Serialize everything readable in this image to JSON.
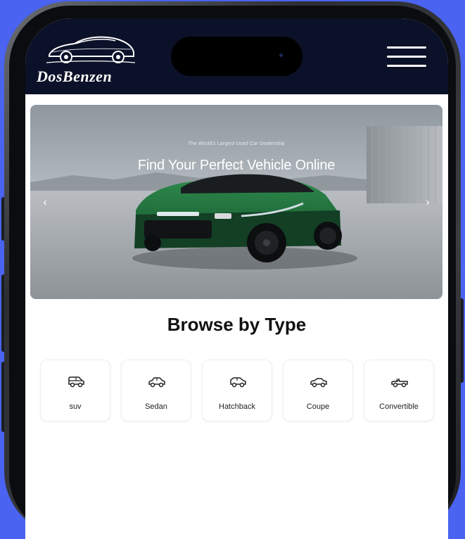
{
  "header": {
    "brand": "DosBenzen"
  },
  "hero": {
    "tagline": "The World's Largest Used Car Dealership",
    "title": "Find Your Perfect Vehicle Online",
    "prev_icon": "‹",
    "next_icon": "›"
  },
  "browse": {
    "title": "Browse by Type",
    "types": [
      {
        "label": "suv",
        "icon": "suv-icon"
      },
      {
        "label": "Sedan",
        "icon": "sedan-icon"
      },
      {
        "label": "Hatchback",
        "icon": "hatchback-icon"
      },
      {
        "label": "Coupe",
        "icon": "coupe-icon"
      },
      {
        "label": "Convertible",
        "icon": "convertible-icon"
      }
    ]
  },
  "colors": {
    "background": "#4a63f0",
    "navbar": "#0b1128",
    "car_accent": "#1f6b3a"
  }
}
